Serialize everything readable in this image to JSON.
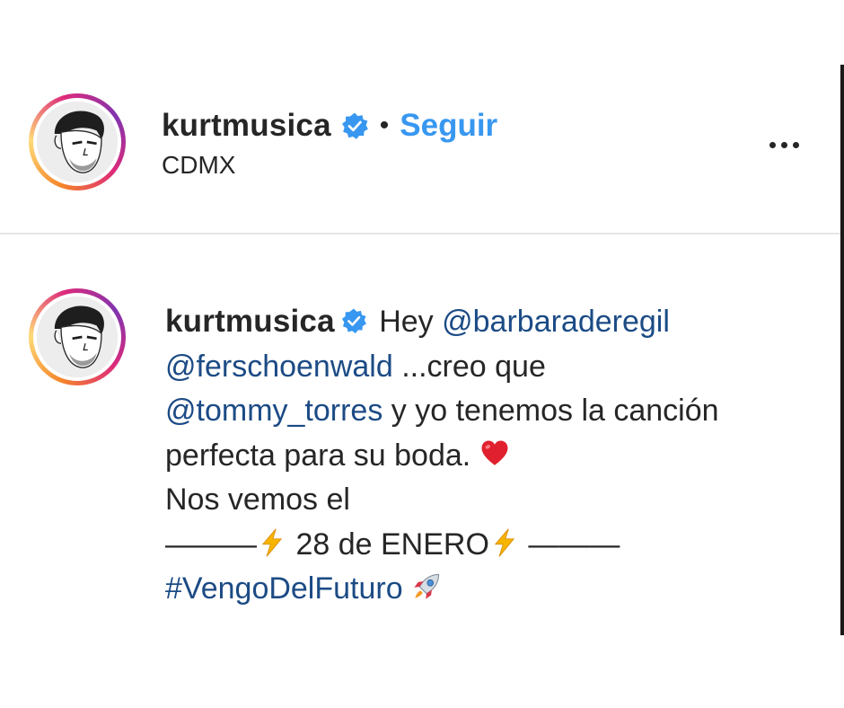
{
  "header": {
    "username": "kurtmusica",
    "separator": "•",
    "follow_label": "Seguir",
    "location": "CDMX",
    "icons": {
      "verified": "verified-badge-icon",
      "more": "more-options-icon"
    }
  },
  "comment": {
    "username": "kurtmusica",
    "text_1": "Hey",
    "mention_1": "@barbaraderegil",
    "mention_2": "@ferschoenwald",
    "text_2": "...creo que",
    "mention_3": "@tommy_torres",
    "text_3": "y yo tenemos la canción perfecta para su boda.",
    "text_4": "Nos vemos el",
    "dashes": "———",
    "date": "28 de ENERO",
    "hashtag": "#VengoDelFuturo",
    "emojis": [
      "heart-emoji",
      "lightning-emoji",
      "lightning-emoji",
      "rocket-emoji"
    ]
  },
  "colors": {
    "link_blue": "#3897f0",
    "mention_blue": "#1c4b85",
    "verified_blue": "#3897f0",
    "text": "#262626"
  }
}
